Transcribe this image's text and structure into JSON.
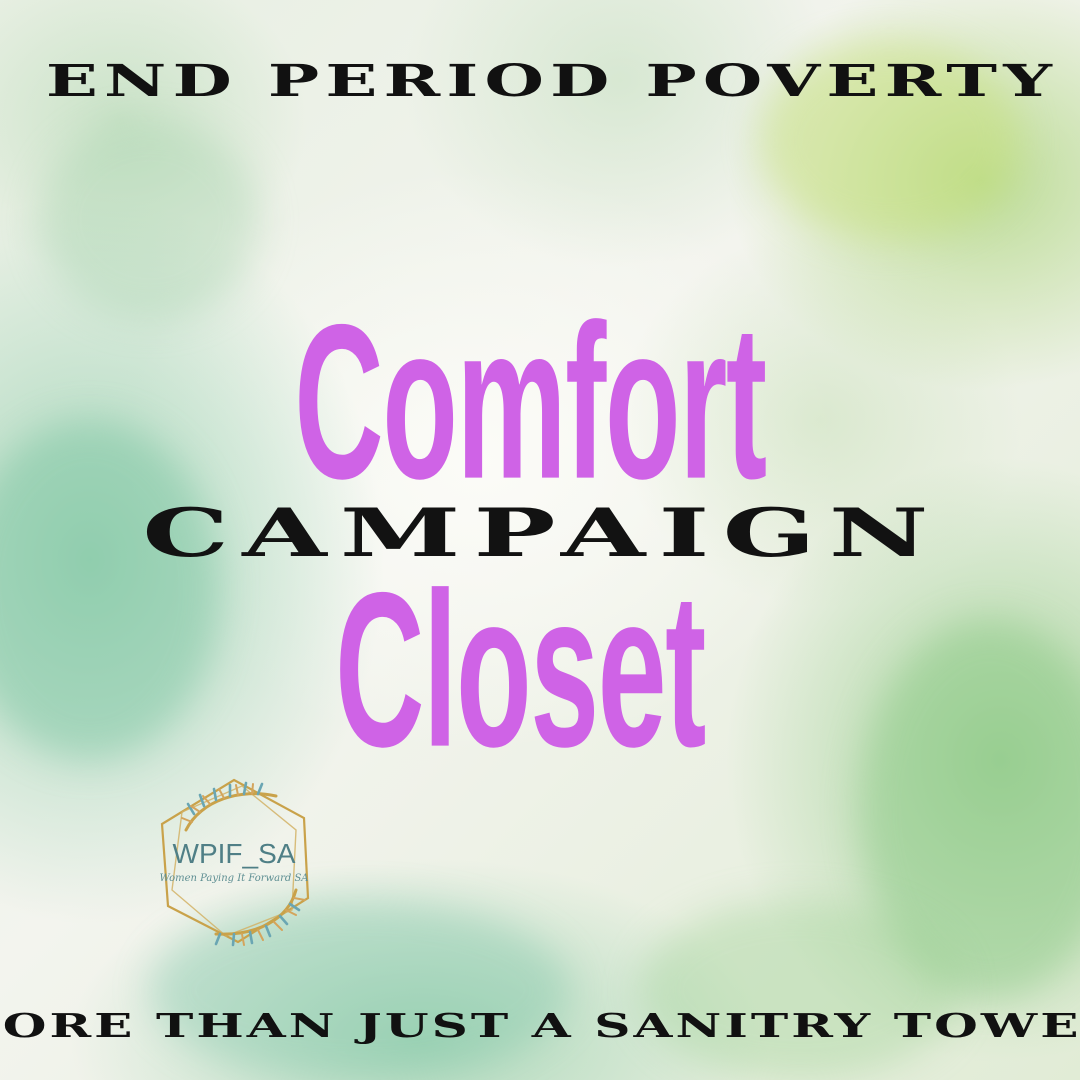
{
  "poster": {
    "top_heading": "END PERIOD POVERTY",
    "title_line_1": "Comfort",
    "overlay_word": "CAMPAIGN",
    "title_line_2": "Closet",
    "bottom_heading": "MORE THAN JUST A SANITRY TOWEL"
  },
  "logo": {
    "name": "WPIF_SA",
    "tagline": "Women Paying It Forward SA"
  },
  "colors": {
    "title_purple": "#cf63e6",
    "heading_black": "#111111",
    "logo_teal": "#4f7f86",
    "wash_green": "#8fd0a8",
    "wash_lime": "#bfd98a",
    "logo_gold": "#c9a24a"
  },
  "icons": {
    "logo_ring": "feather-wreath-icon",
    "logo_frame": "gold-hexagon-frame-icon"
  }
}
